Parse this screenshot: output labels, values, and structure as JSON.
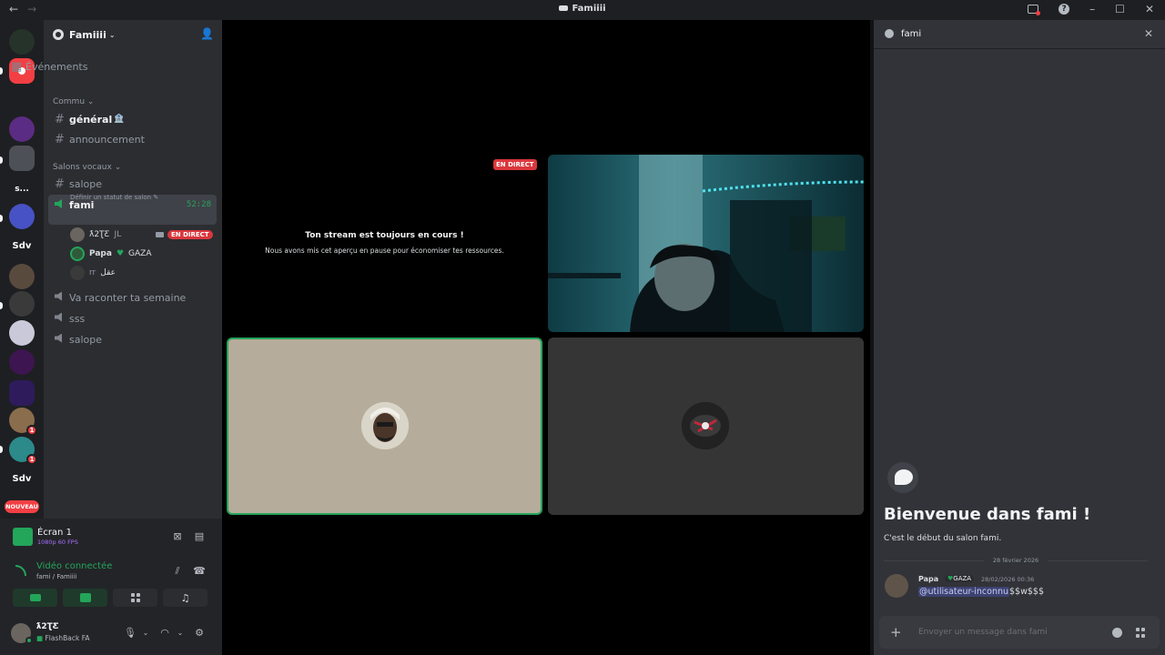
{
  "titlebar": {
    "title": "Famiiii"
  },
  "rail": {
    "server_labels": [
      "s...",
      "Sdv",
      "Sdv"
    ],
    "badge_count": "1",
    "new_label": "NOUVEAU"
  },
  "sidebar": {
    "guild_name": "Famiiii",
    "events_label": "Événements",
    "category_1": "Commu",
    "channels_text": [
      {
        "label": "général",
        "emoji": "🏦"
      },
      {
        "label": "announcement"
      }
    ],
    "category_2": "Salons vocaux",
    "voice_channels": {
      "salope_1": "salope",
      "fami": "fami",
      "fami_timer": "52:28",
      "fami_status_hint": "Définir un statut de salon",
      "va_raconter": "Va raconter ta semaine",
      "sss": "sss",
      "salope_2": "salope"
    },
    "voice_users": [
      {
        "name": "ƛ2ƮƸ",
        "tag": "JL",
        "live": "EN DIRECT"
      },
      {
        "name": "Papa",
        "tag": "GAZA"
      },
      {
        "name": "rr",
        "tag": "عقل"
      }
    ]
  },
  "stream_panel": {
    "title": "Écran 1",
    "sub": "1080p 60 FPS"
  },
  "voice_panel": {
    "title": "Vidéo connectée",
    "sub": "fami / Famiiii"
  },
  "user_panel": {
    "name": "ƛ2ƮƸ",
    "status": "FlashBack FA"
  },
  "stage": {
    "live_tag": "EN DIRECT",
    "paused_title": "Ton stream est toujours en cours !",
    "paused_sub": "Nous avons mis cet aperçu en pause pour économiser tes ressources."
  },
  "chat": {
    "channel": "fami",
    "welcome_title": "Bienvenue dans fami !",
    "welcome_sub": "C'est le début du salon fami.",
    "date_divider": "28 février 2026",
    "message": {
      "author": "Papa",
      "tag": "GAZA",
      "time": "28/02/2026 00:36",
      "mention": "@utilisateur-inconnu",
      "text": "$$w$$$"
    },
    "composer_placeholder": "Envoyer un message dans fami"
  },
  "colors": {
    "accent_green": "#23a55a",
    "live_red": "#da373c",
    "mention_purple": "#a970ff"
  }
}
